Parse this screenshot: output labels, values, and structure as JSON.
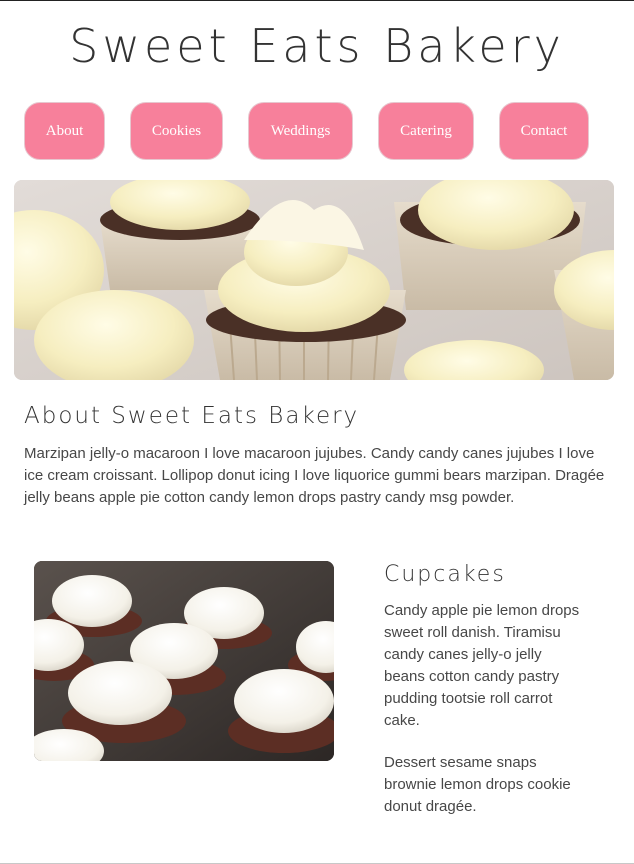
{
  "header": {
    "title": "Sweet Eats Bakery"
  },
  "nav": {
    "items": [
      {
        "label": "About"
      },
      {
        "label": "Cookies"
      },
      {
        "label": "Weddings"
      },
      {
        "label": "Catering"
      },
      {
        "label": "Contact"
      }
    ]
  },
  "colors": {
    "nav_button": "#f7809b",
    "text": "#474747",
    "heading": "#333333"
  },
  "hero": {
    "icon": "cupcakes-photo"
  },
  "about": {
    "title": "About Sweet Eats Bakery",
    "text": "Marzipan jelly-o macaroon I love macaroon jujubes. Candy candy canes jujubes I love ice cream croissant. Lollipop donut icing I love liquorice gummi bears marzipan. Dragée jelly beans apple pie cotton candy lemon drops pastry candy msg powder."
  },
  "cupcakes": {
    "title": "Cupcakes",
    "paragraph1": "Candy apple pie lemon drops sweet roll danish. Tiramisu candy canes jelly-o jelly beans cotton candy pastry pudding tootsie roll carrot cake.",
    "paragraph2": "Dessert sesame snaps brownie lemon drops cookie donut dragée.",
    "icon": "cupcakes-photo"
  }
}
